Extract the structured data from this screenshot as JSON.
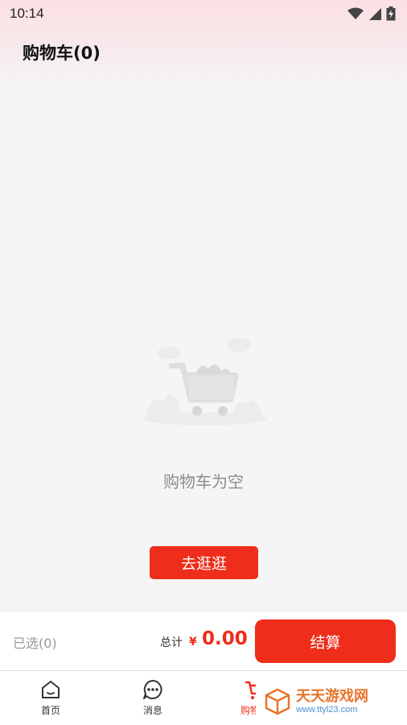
{
  "status_bar": {
    "time": "10:14",
    "icons": [
      "wifi-icon",
      "signal-icon",
      "battery-icon"
    ]
  },
  "header": {
    "title": "购物车(0)"
  },
  "empty_state": {
    "illustration": "empty-cart-icon",
    "message": "购物车为空",
    "button_label": "去逛逛"
  },
  "checkout": {
    "selected_label": "已选(0)",
    "total_label": "总计",
    "currency": "¥",
    "total_amount": "0.00",
    "checkout_label": "结算"
  },
  "tabs": [
    {
      "label": "首页",
      "icon": "home-icon",
      "active": false
    },
    {
      "label": "消息",
      "icon": "message-icon",
      "active": false
    },
    {
      "label": "购物车",
      "icon": "cart-icon",
      "active": true
    }
  ],
  "watermark": {
    "title": "天天游戏网",
    "url": "www.ttyl23.com"
  },
  "colors": {
    "accent": "#ee2d1a",
    "header_gradient_top": "#fbdfe3",
    "background": "#f5f5f5"
  }
}
